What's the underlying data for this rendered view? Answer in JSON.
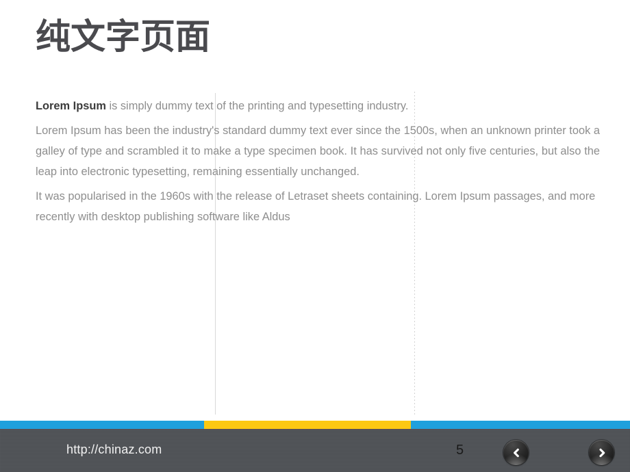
{
  "slide": {
    "title": "纯文字页面",
    "paragraphs": [
      {
        "id": "p1",
        "lead": "Lorem Ipsum",
        "rest": " is simply dummy text of the printing and typesetting industry."
      },
      {
        "id": "p2",
        "text": "Lorem Ipsum has been the industry's standard dummy text ever since the 1500s, when an unknown printer took a galley of type and scrambled it to make a type specimen book. It has survived not only five centuries, but also the leap into electronic typesetting, remaining essentially unchanged."
      },
      {
        "id": "p3",
        "text": "It was popularised in the 1960s with the release of Letraset sheets containing. Lorem Ipsum passages, and more recently with desktop publishing software like Aldus"
      }
    ]
  },
  "footer": {
    "url": "http://chinaz.com",
    "page_number": "5",
    "prev_label": "‹",
    "next_label": "›"
  },
  "colors": {
    "accent_blue": "#1fa0dd",
    "accent_yellow": "#fcc812",
    "footer_band": "#4e5155",
    "title_gray": "#4a4a4e",
    "body_gray": "#8e8e8e",
    "lead_dark": "#3c3c3c"
  }
}
